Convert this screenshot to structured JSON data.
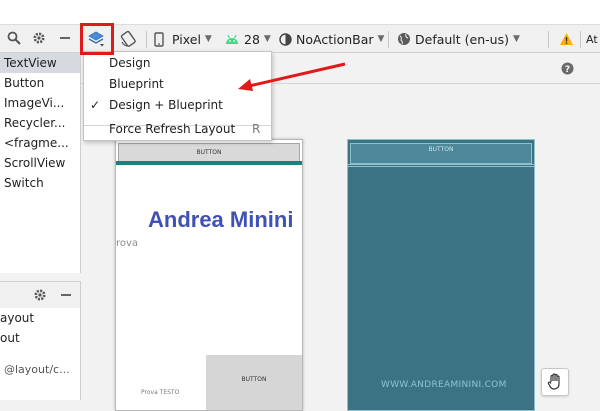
{
  "toolbar": {
    "device": "Pixel",
    "api": "28",
    "theme": "NoActionBar",
    "locale": "Default (en-us)",
    "attributes_label": "At"
  },
  "palette": {
    "items": [
      "TextView",
      "Button",
      "ImageVi...",
      "Recycler...",
      "<fragme...",
      "ScrollView",
      "Switch"
    ]
  },
  "component_tree": {
    "items": [
      "ayout",
      "out",
      "@layout/c..."
    ]
  },
  "dropdown": {
    "items": [
      {
        "label": "Design",
        "checked": false
      },
      {
        "label": "Blueprint",
        "checked": false
      },
      {
        "label": "Design + Blueprint",
        "checked": true
      },
      {
        "label": "Force Refresh Layout",
        "shortcut": "R"
      }
    ],
    "check_glyph": "✓"
  },
  "design_preview": {
    "top_button": "BUTTON",
    "title": "Andrea Minini",
    "prova": "rova",
    "bottom_button": "BUTTON",
    "small_text": "Prova TESTO"
  },
  "blueprint_preview": {
    "top_button": "BUTTON",
    "watermark": "WWW.ANDREAMININI.COM"
  },
  "colors": {
    "accent_red": "#e01919",
    "design_title": "#3f51b5",
    "design_bar": "#15857a",
    "blueprint_bg": "#3b7384",
    "android_green": "#3ddc84",
    "warning": "#f4b400"
  }
}
